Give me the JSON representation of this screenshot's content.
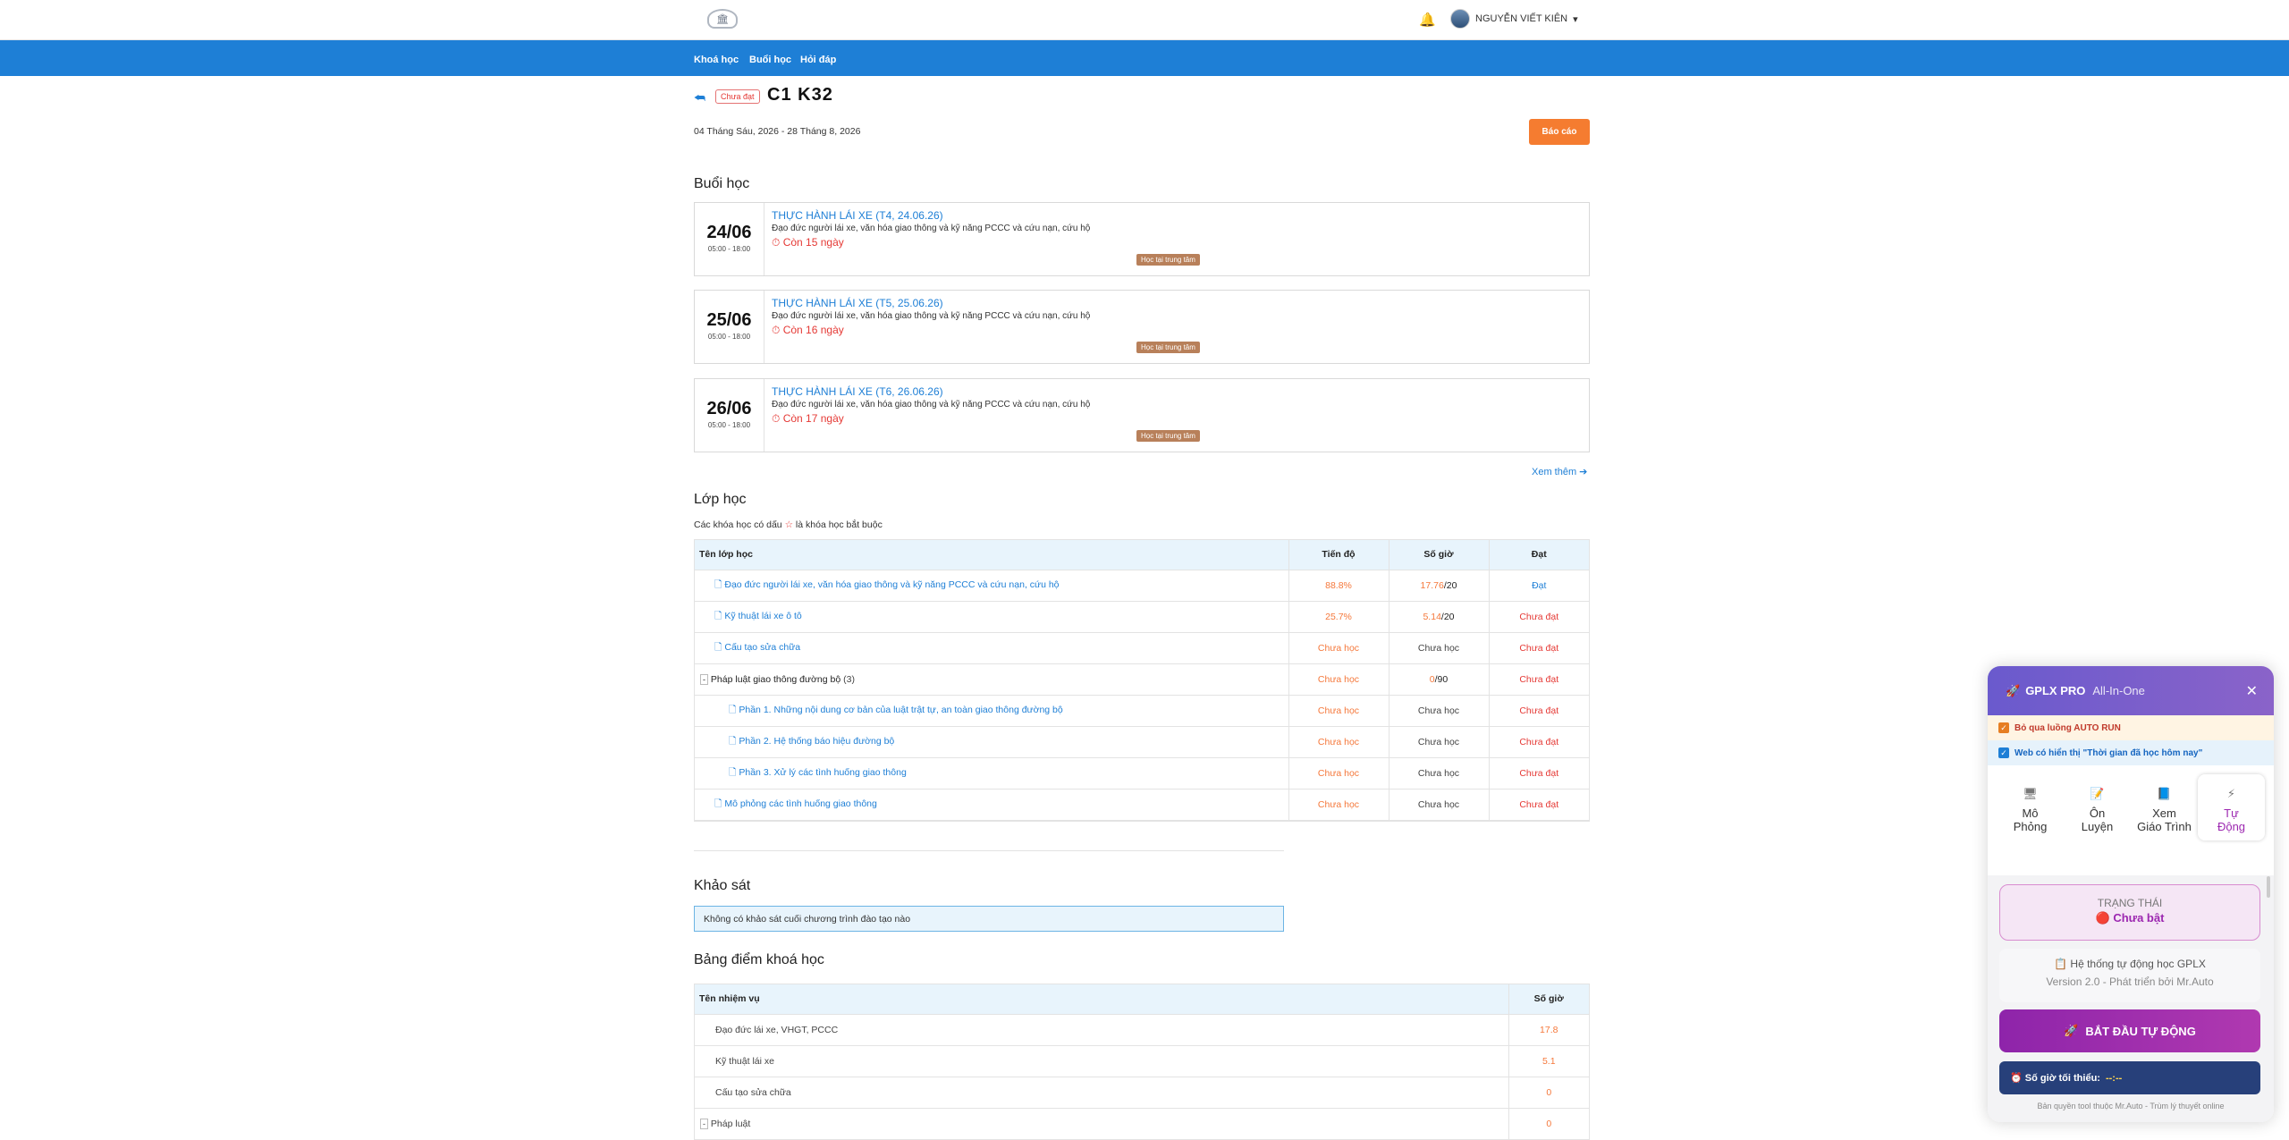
{
  "header": {
    "logo_glyph": "🏛",
    "bell_glyph": "🔔",
    "user_name": "NGUYỄN VIẾT KIÊN",
    "user_caret": "▾"
  },
  "nav": {
    "items": [
      "Khoá học",
      "Buổi học",
      "Hỏi đáp"
    ]
  },
  "course": {
    "back_glyph": "⮪",
    "status": "Chưa đạt",
    "title": "C1 K32",
    "dates": "04 Tháng Sáu, 2026 - 28 Tháng 8, 2026",
    "report": "Báo cáo"
  },
  "sessions_section": {
    "heading": "Buổi học",
    "items": [
      {
        "day": "24/06",
        "time": "05:00 - 18:00",
        "title": "THỰC HÀNH LÁI XE (T4, 24.06.26)",
        "desc": "Đạo đức người lái xe, văn hóa giao thông và kỹ năng PCCC và cứu nạn, cứu hộ",
        "remain": "Còn 15 ngày",
        "tag": "Học tại trung tâm"
      },
      {
        "day": "25/06",
        "time": "05:00 - 18:00",
        "title": "THỰC HÀNH LÁI XE (T5, 25.06.26)",
        "desc": "Đạo đức người lái xe, văn hóa giao thông và kỹ năng PCCC và cứu nạn, cứu hộ",
        "remain": "Còn 16 ngày",
        "tag": "Học tại trung tâm"
      },
      {
        "day": "26/06",
        "time": "05:00 - 18:00",
        "title": "THỰC HÀNH LÁI XE (T6, 26.06.26)",
        "desc": "Đạo đức người lái xe, văn hóa giao thông và kỹ năng PCCC và cứu nạn, cứu hộ",
        "remain": "Còn 17 ngày",
        "tag": "Học tại trung tâm"
      }
    ],
    "more": "Xem thêm ➔"
  },
  "classes": {
    "heading": "Lớp học",
    "note_pre": "Các khóa học có dấu",
    "note_star": "☆",
    "note_post": "là khóa học bắt buộc",
    "cols": [
      "Tên lớp học",
      "Tiến độ",
      "Số giờ",
      "Đạt"
    ],
    "rows": [
      {
        "name": "Đạo đức người lái xe, văn hóa giao thông và kỹ năng PCCC và cứu nạn, cứu hộ",
        "progress": "88.8%",
        "hours_a": "17.76",
        "hours_b": "/20",
        "pass": "Đạt"
      },
      {
        "name": "Kỹ thuật lái xe ô tô",
        "progress": "25.7%",
        "hours_a": "5.14",
        "hours_b": "/20",
        "pass": "Chưa đạt"
      },
      {
        "name": "Cấu tạo sửa chữa",
        "progress": "Chưa học",
        "hours_a": "",
        "hours_b": "Chưa học",
        "pass": "Chưa đạt"
      },
      {
        "name": "Pháp luật giao thông đường bộ",
        "count": "(3)",
        "progress": "Chưa học",
        "hours_a": "0",
        "hours_b": "/90",
        "pass": "Chưa đạt"
      },
      {
        "name": "Phần 1. Những nội dung cơ bản của luật trật tự, an toàn giao thông đường bộ",
        "progress": "Chưa học",
        "hours_a": "",
        "hours_b": "Chưa học",
        "pass": "Chưa đạt"
      },
      {
        "name": "Phần 2. Hệ thống báo hiệu đường bộ",
        "progress": "Chưa học",
        "hours_a": "",
        "hours_b": "Chưa học",
        "pass": "Chưa đạt"
      },
      {
        "name": "Phần 3. Xử lý các tình huống giao thông",
        "progress": "Chưa học",
        "hours_a": "",
        "hours_b": "Chưa học",
        "pass": "Chưa đạt"
      },
      {
        "name": "Mô phỏng các tình huống giao thông",
        "progress": "Chưa học",
        "hours_a": "",
        "hours_b": "Chưa học",
        "pass": "Chưa đạt"
      }
    ]
  },
  "survey": {
    "heading": "Khảo sát",
    "empty": "Không có khảo sát cuối chương trình đào tạo nào"
  },
  "scores": {
    "heading": "Bảng điểm khoá học",
    "cols": [
      "Tên nhiệm vụ",
      "Số giờ"
    ],
    "rows": [
      {
        "name": "Đạo đức lái xe, VHGT, PCCC",
        "hours": "17.8"
      },
      {
        "name": "Kỹ thuật lái xe",
        "hours": "5.1"
      },
      {
        "name": "Cấu tạo sửa chữa",
        "hours": "0"
      },
      {
        "name": "Pháp luật",
        "hours": "0"
      }
    ]
  },
  "panel": {
    "title": "GPLX PRO",
    "subtitle": "All-In-One",
    "close": "✕",
    "rocket": "🚀",
    "opt1": "Bỏ qua luồng AUTO RUN",
    "opt2": "Web có hiển thị \"Thời gian đã học hôm nay\"",
    "tabs": [
      {
        "icon": "🖥",
        "l1": "Mô",
        "l2": "Phỏng"
      },
      {
        "icon": "📝",
        "l1": "Ôn",
        "l2": "Luyện"
      },
      {
        "icon": "📘",
        "l1": "Xem",
        "l2": "Giáo Trình"
      },
      {
        "icon": "⚡",
        "l1": "Tự",
        "l2": "Động"
      }
    ],
    "status_label": "TRẠNG THÁI",
    "status_value": "🔴 Chưa bật",
    "sys_title": "📋 Hệ thống tự động học GPLX",
    "sys_version": "Version 2.0 - Phát triển bởi Mr.Auto",
    "start_label": "BẮT ĐẦU TỰ ĐỘNG",
    "min_label": "⏰ Số giờ tối thiểu:",
    "min_value": "--:--",
    "copyright": "Bản quyền tool thuộc Mr.Auto - Trùm lý thuyết online"
  }
}
